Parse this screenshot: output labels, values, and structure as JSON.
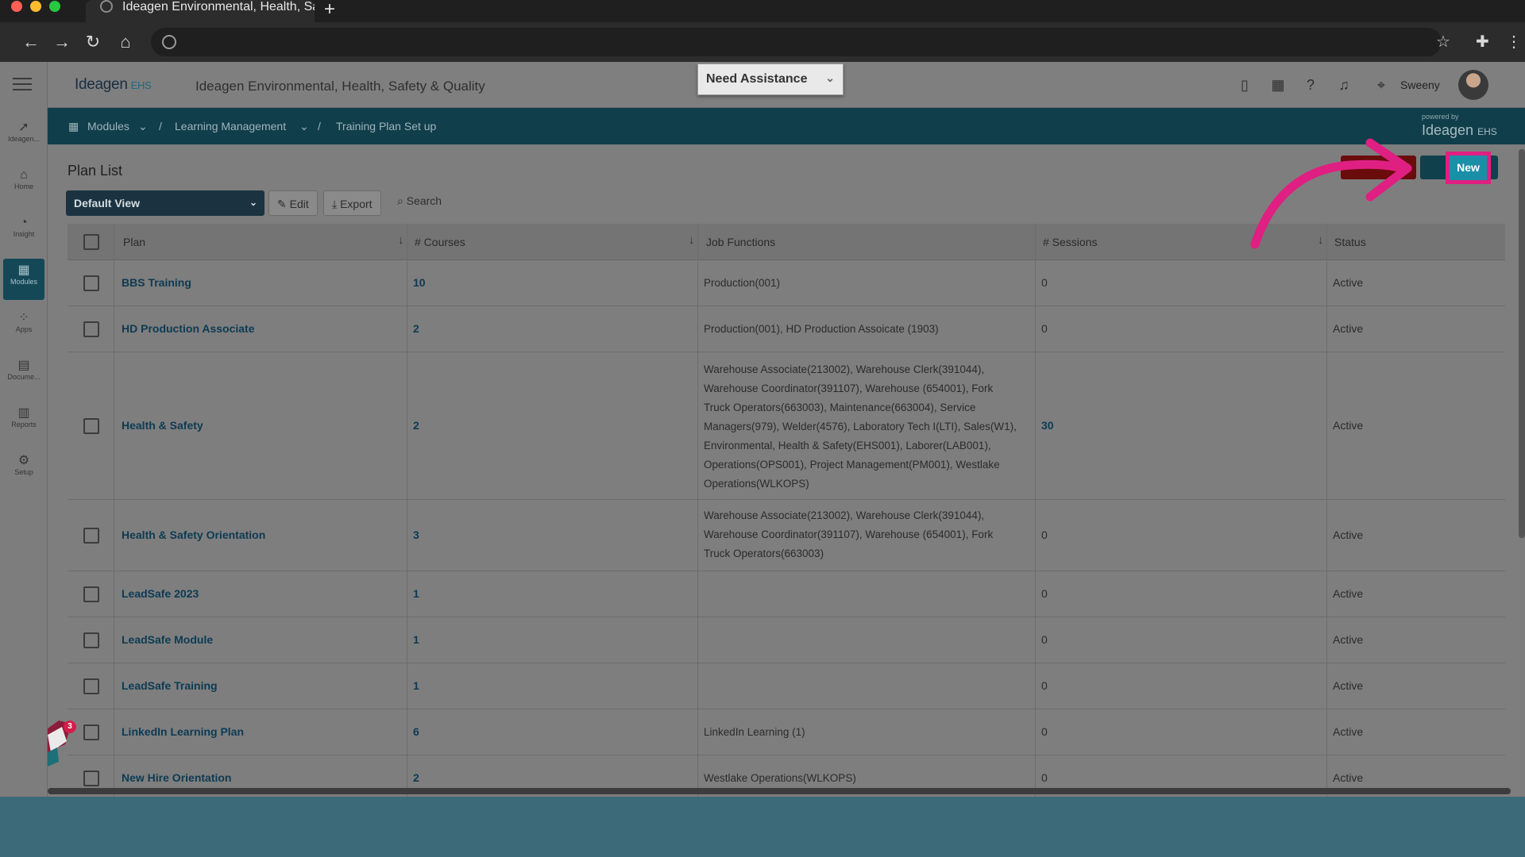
{
  "browser": {
    "tab_title": "Ideagen Environmental, Health, Sa",
    "new_tab": "+"
  },
  "header": {
    "logo": "Ideagen",
    "logo_suffix": "EHS",
    "app_title": "Ideagen Environmental, Health, Safety & Quality",
    "assist_label": "Need Assistance",
    "user_name": "Sweeny"
  },
  "left_nav": [
    {
      "label": "Ideagen...",
      "icon": "ideagen-icon"
    },
    {
      "label": "Home",
      "icon": "home-icon"
    },
    {
      "label": "Insight",
      "icon": "insight-icon"
    },
    {
      "label": "Modules",
      "icon": "modules-icon",
      "active": true
    },
    {
      "label": "Apps",
      "icon": "apps-icon"
    },
    {
      "label": "Docume...",
      "icon": "document-icon"
    },
    {
      "label": "Reports",
      "icon": "reports-icon"
    },
    {
      "label": "Setup",
      "icon": "setup-icon"
    }
  ],
  "breadcrumb": {
    "modules": "Modules",
    "learning": "Learning Management",
    "current": "Training Plan Set up",
    "sep": "/"
  },
  "powered_by": {
    "text": "powered by",
    "logo": "Ideagen",
    "suffix": "EHS"
  },
  "page": {
    "title": "Plan List",
    "new_button": "New"
  },
  "toolbar": {
    "view": "Default View",
    "edit": "Edit",
    "export": "Export",
    "search": "Search"
  },
  "columns": {
    "plan": "Plan",
    "courses": "# Courses",
    "job_functions": "Job Functions",
    "sessions": "# Sessions",
    "status": "Status"
  },
  "rows": [
    {
      "plan": "BBS Training",
      "courses": "10",
      "jobs": "Production(001)",
      "sessions": "0",
      "status": "Active"
    },
    {
      "plan": "HD Production Associate",
      "courses": "2",
      "jobs": "Production(001), HD Production Assoicate (1903)",
      "sessions": "0",
      "status": "Active"
    },
    {
      "plan": "Health & Safety",
      "courses": "2",
      "jobs": [
        "Warehouse Associate(213002), Warehouse Clerk(391044),",
        "Warehouse Coordinator(391107), Warehouse (654001), Fork",
        "Truck Operators(663003), Maintenance(663004), Service",
        "Managers(979), Welder(4576), Laboratory Tech I(LTI), Sales(W1),",
        "Environmental, Health & Safety(EHS001), Laborer(LAB001),",
        "Operations(OPS001), Project Management(PM001), Westlake",
        "Operations(WLKOPS)"
      ],
      "sessions": "30",
      "status": "Active"
    },
    {
      "plan": "Health & Safety Orientation",
      "courses": "3",
      "jobs": [
        "Warehouse Associate(213002), Warehouse Clerk(391044),",
        "Warehouse Coordinator(391107), Warehouse (654001), Fork",
        "Truck Operators(663003)"
      ],
      "sessions": "0",
      "status": "Active"
    },
    {
      "plan": "LeadSafe 2023",
      "courses": "1",
      "jobs": "",
      "sessions": "0",
      "status": "Active"
    },
    {
      "plan": "LeadSafe Module",
      "courses": "1",
      "jobs": "",
      "sessions": "0",
      "status": "Active"
    },
    {
      "plan": "LeadSafe Training",
      "courses": "1",
      "jobs": "",
      "sessions": "0",
      "status": "Active"
    },
    {
      "plan": "LinkedIn Learning Plan",
      "courses": "6",
      "jobs": "LinkedIn Learning (1)",
      "sessions": "0",
      "status": "Active"
    },
    {
      "plan": "New Hire Orientation",
      "courses": "2",
      "jobs": "Westlake Operations(WLKOPS)",
      "sessions": "0",
      "status": "Active"
    }
  ],
  "notifications": {
    "badge": "3"
  },
  "colors": {
    "annotation": "#e01f82",
    "new_button": "#1a8fa8",
    "brand_dark": "#113e4b"
  }
}
